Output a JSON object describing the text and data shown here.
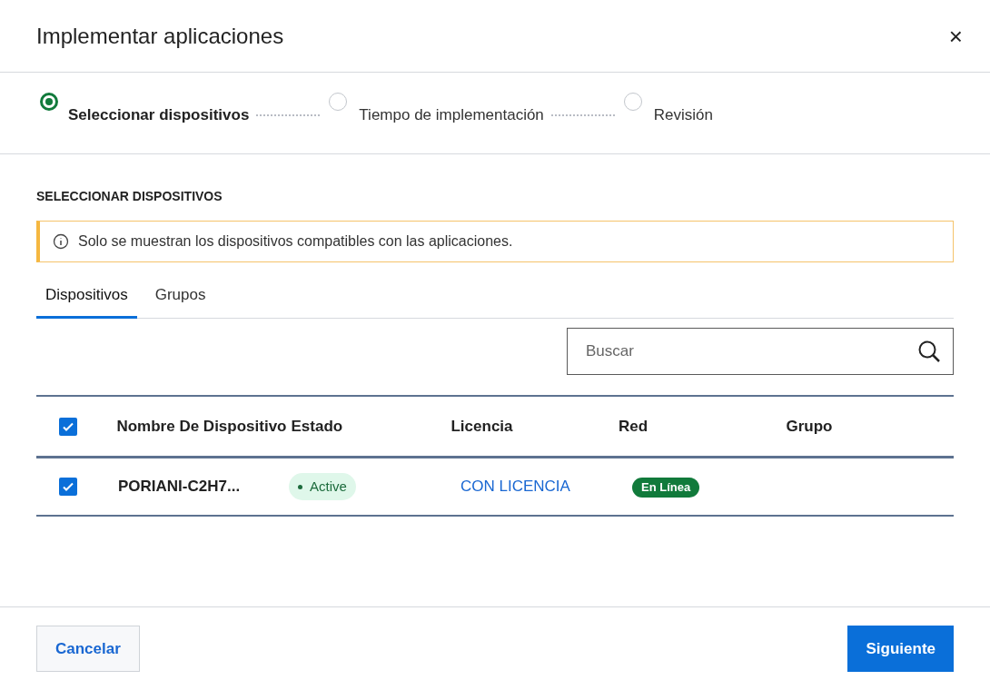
{
  "dialog": {
    "title": "Implementar aplicaciones",
    "close": "×"
  },
  "steps": [
    {
      "label": "Seleccionar dispositivos",
      "selected": true
    },
    {
      "label": "Tiempo de implementación",
      "selected": false
    },
    {
      "label": "Revisión",
      "selected": false
    }
  ],
  "section_title": "SELECCIONAR DISPOSITIVOS",
  "notice": "Solo se muestran los dispositivos compatibles con las aplicaciones.",
  "tabs": [
    {
      "label": "Dispositivos",
      "selected": true
    },
    {
      "label": "Grupos",
      "selected": false
    }
  ],
  "search": {
    "placeholder": "Buscar"
  },
  "table": {
    "select_all": true,
    "columns": [
      "Nombre De Dispositivo",
      "Estado",
      "Licencia",
      "Red",
      "Grupo"
    ],
    "rows": [
      {
        "checked": true,
        "name": "PORIANI-C2H7...",
        "status": "Active",
        "license": "CON LICENCIA",
        "network": "En Línea"
      }
    ]
  },
  "buttons": {
    "cancel": "Cancelar",
    "next": "Siguiente"
  }
}
